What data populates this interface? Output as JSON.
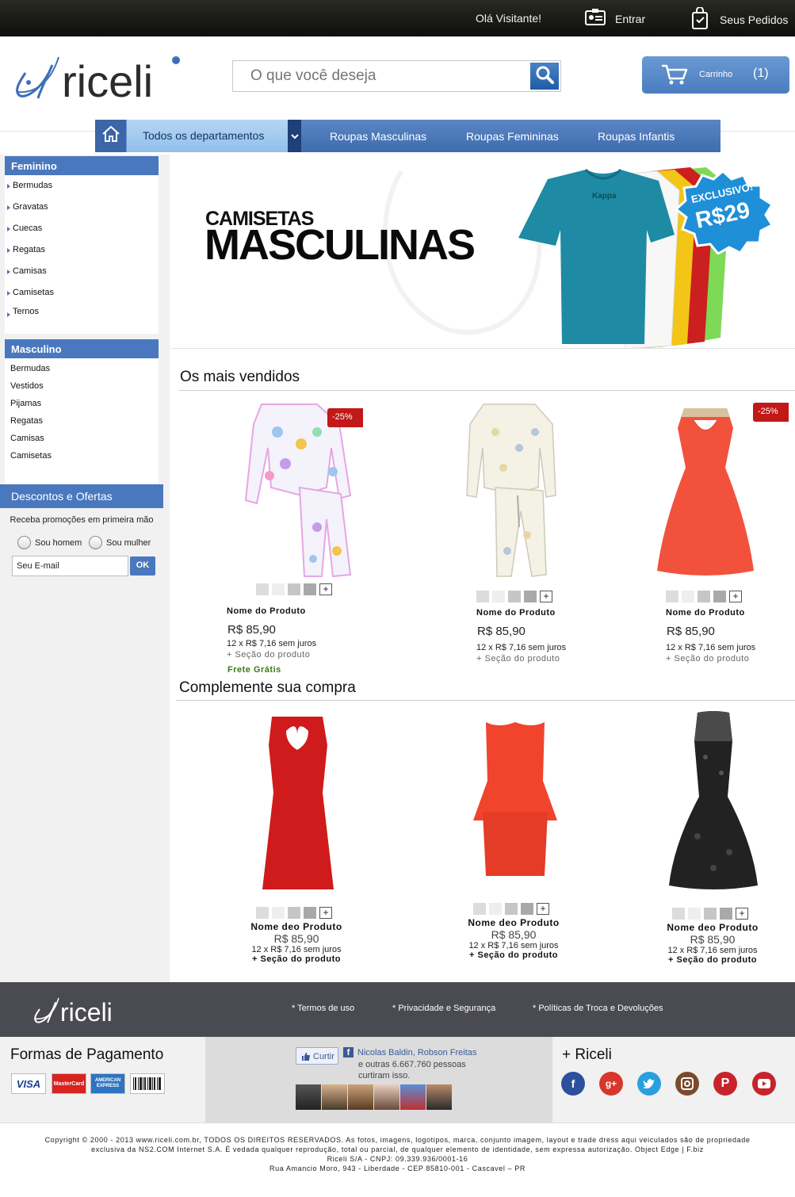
{
  "topbar": {
    "greeting": "Olá Visitante!",
    "login": "Entrar",
    "orders": "Seus Pedidos"
  },
  "brand": {
    "name": "riceli",
    "accent": "#4a78be"
  },
  "search": {
    "placeholder": "O que você deseja"
  },
  "cart": {
    "label": "Carrinho",
    "count": "(1)"
  },
  "nav": {
    "all": "Todos os departamentos",
    "items": [
      "Roupas Masculinas",
      "Roupas Femininas",
      "Roupas Infantis"
    ]
  },
  "sidebar": {
    "feminino": {
      "title": "Feminino",
      "items": [
        "Bermudas",
        "Gravatas",
        "Cuecas",
        "Regatas",
        "Camisas",
        "Camisetas",
        "Ternos"
      ]
    },
    "masculino": {
      "title": "Masculino",
      "items": [
        "Bermudas",
        "Vestidos",
        "Pijamas",
        "Regatas",
        "Camisas",
        "Camisetas"
      ]
    },
    "offers": {
      "title": "Descontos e Ofertas",
      "text": "Receba promoções em primeira mão",
      "male": "Sou homem",
      "female": "Sou mulher",
      "email_placeholder": "Seu E-mail",
      "ok": "OK"
    }
  },
  "banner": {
    "line1": "CAMISETAS",
    "line2": "MASCULINAS",
    "tag_top": "EXCLUSIVO!",
    "tag_price": "R$29",
    "shirt_brand": "Kappa"
  },
  "bestsellers": {
    "title": "Os mais vendidos",
    "products": [
      {
        "name": "Nome do Produto",
        "price": "R$ 85,90",
        "installments": "12 x R$ 7,16 sem juros",
        "section": "+ Seção do produto",
        "badge": "-25%",
        "shipping": "Frete Grátis"
      },
      {
        "name": "Nome do Produto",
        "price": "R$ 85,90",
        "installments": "12 x R$ 7,16 sem juros",
        "section": "+ Seção do produto"
      },
      {
        "name": "Nome do Produto",
        "price": "R$ 85,90",
        "installments": "12 x R$ 7,16 sem juros",
        "section": "+ Seção do produto",
        "badge": "-25%"
      }
    ]
  },
  "complement": {
    "title": "Complemente sua compra",
    "products": [
      {
        "name": "Nome deo Produto",
        "price": "R$ 85,90",
        "installments": "12 x R$ 7,16 sem juros",
        "section": "+ Seção do produto"
      },
      {
        "name": "Nome deo Produto",
        "price": "R$ 85,90",
        "installments": "12 x R$ 7,16 sem juros",
        "section": "+ Seção do produto"
      },
      {
        "name": "Nome deo Produto",
        "price": "R$ 85,90",
        "installments": "12 x R$ 7,16 sem juros",
        "section": "+ Seção do produto"
      }
    ]
  },
  "swatch_plus": "+",
  "footer": {
    "links": [
      "* Termos de uso",
      "* Privacidade e Segurança",
      "* Políticas de Troca e Devoluções"
    ],
    "payment_title": "Formas de Pagamento",
    "cards": [
      "VISA",
      "MasterCard",
      "AMERICAN EXPRESS"
    ],
    "fb_like": "Curtir",
    "fb_names": "Nicolas Baldin, Robson Freitas",
    "fb_others": "e outras 6.667.760 pessoas curtiram isso.",
    "social_title": "+ Riceli",
    "copyright": [
      "Copyright © 2000 - 2013 www.riceli.com.br, TODOS OS DIREITOS RESERVADOS. As fotos, imagens, logotipos, marca, conjunto imagem, layout e trade dress aqui veiculados são de propriedade",
      "exclusiva da NS2.COM Internet S.A. É vedada qualquer reprodução, total ou parcial, de qualquer elemento de identidade, sem expressa autorização. Object Edge | F.biz",
      "Riceli S/A - CNPJ: 09.339.936/0001-16",
      "Rua Amancio Moro, 943 - Liberdade - CEP 85810-001 - Cascavel – PR"
    ]
  }
}
